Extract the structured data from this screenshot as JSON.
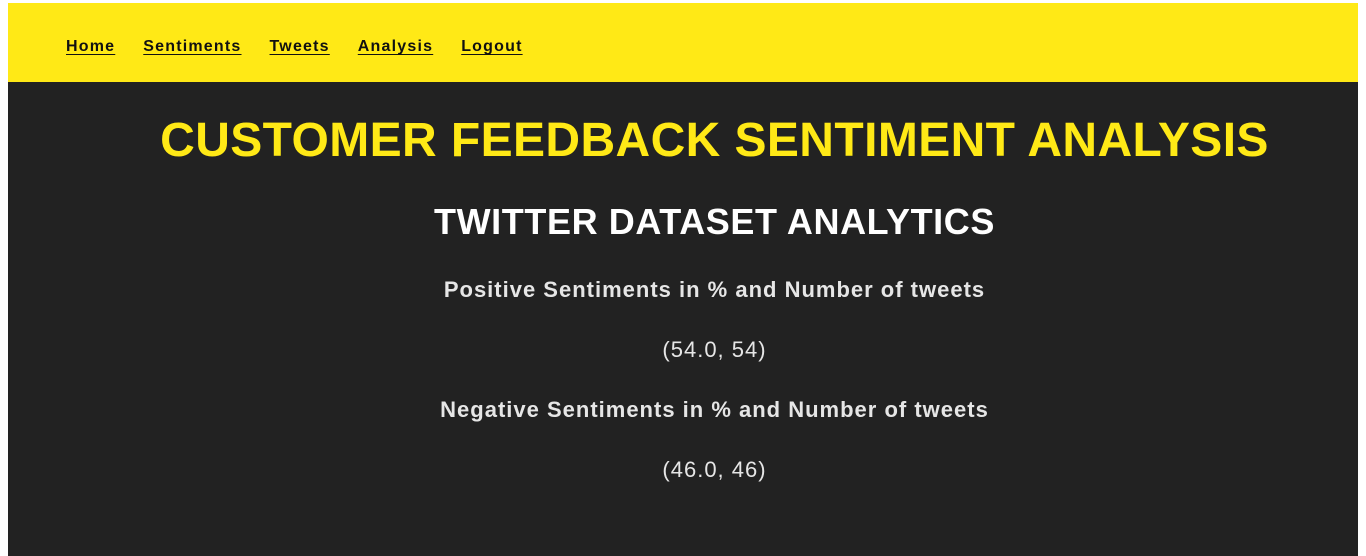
{
  "nav": {
    "items": [
      {
        "label": "Home"
      },
      {
        "label": "Sentiments"
      },
      {
        "label": "Tweets"
      },
      {
        "label": "Analysis"
      },
      {
        "label": "Logout"
      }
    ]
  },
  "main": {
    "title": "CUSTOMER FEEDBACK SENTIMENT ANALYSIS",
    "subtitle": "TWITTER DATASET ANALYTICS",
    "positive": {
      "label": "Positive Sentiments in % and Number of tweets",
      "value": "(54.0, 54)"
    },
    "negative": {
      "label": "Negative Sentiments in % and Number of tweets",
      "value": "(46.0, 46)"
    }
  },
  "colors": {
    "accent": "#ffe916",
    "background": "#222222",
    "text": "#e6e6e6"
  }
}
